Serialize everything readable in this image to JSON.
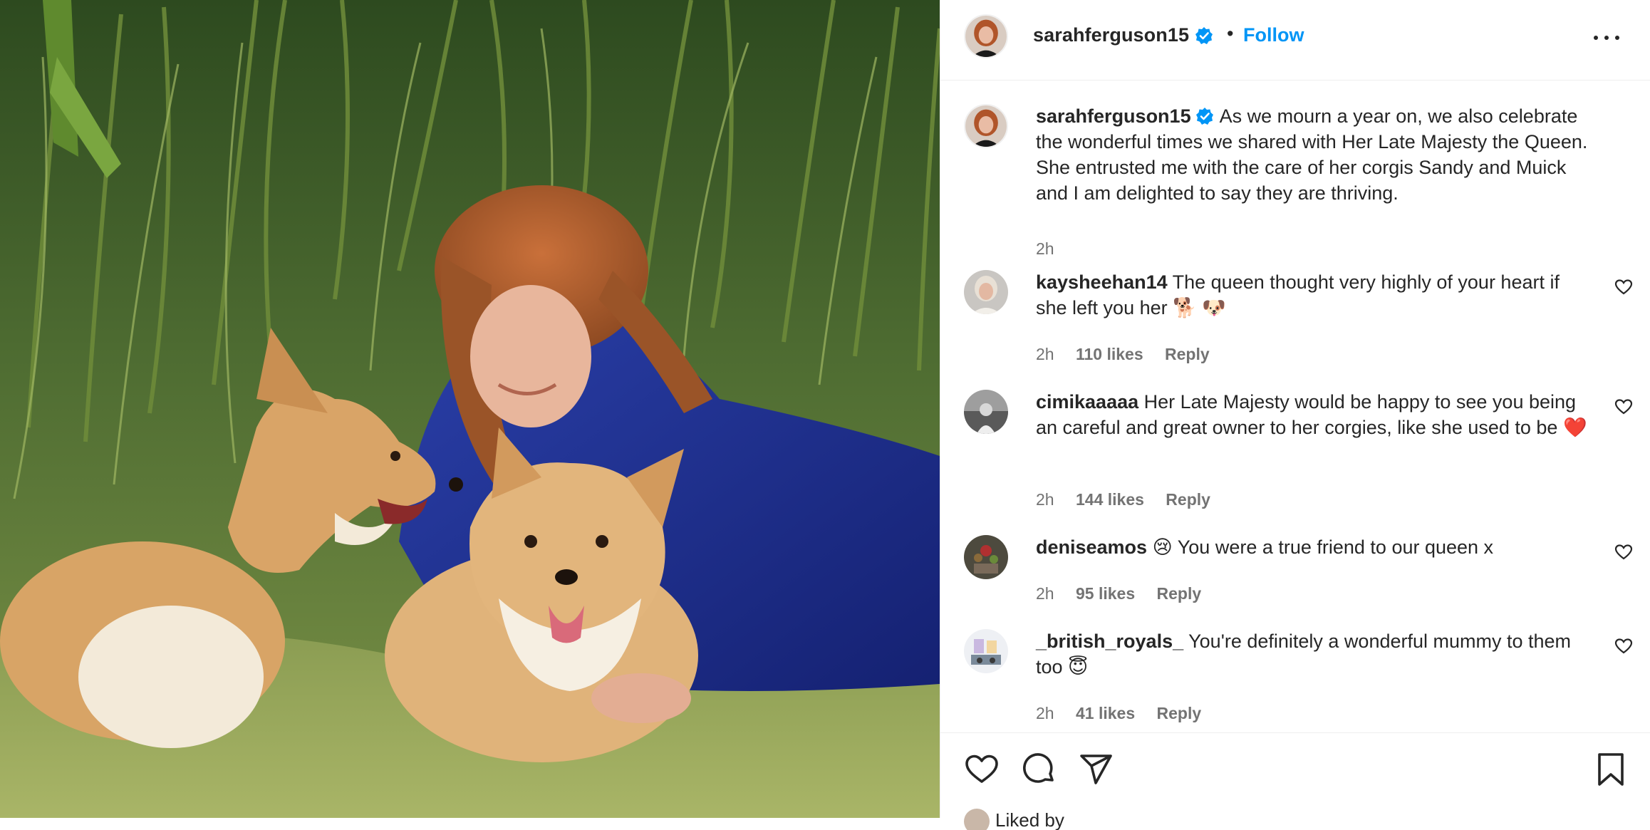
{
  "header": {
    "username": "sarahferguson15",
    "separator": "•",
    "follow_label": "Follow"
  },
  "caption": {
    "username": "sarahferguson15",
    "text": "As we mourn a year on, we also celebrate the wonderful times we shared with Her Late Majesty the Queen. She entrusted me with the care of her corgis Sandy and Muick and I am delighted to say they are thriving.",
    "time": "2h"
  },
  "comments": [
    {
      "username": "kaysheehan14",
      "text": "The queen thought very highly of your heart if she left you her 🐕 🐶",
      "time": "2h",
      "likes": "110 likes",
      "reply": "Reply"
    },
    {
      "username": "cimikaaaaa",
      "text": "Her Late Majesty would be happy to see you being an careful and great owner to her corgies, like she used to be ❤️",
      "time": "2h",
      "likes": "144 likes",
      "reply": "Reply"
    },
    {
      "username": "deniseamos",
      "text": "😢 You were a true friend to our queen x",
      "time": "2h",
      "likes": "95 likes",
      "reply": "Reply"
    },
    {
      "username": "_british_royals_",
      "text": "You're definitely a wonderful mummy to them too 😇",
      "time": "2h",
      "likes": "41 likes",
      "reply": "Reply"
    }
  ],
  "footer": {
    "liked_by": "Liked by"
  },
  "icons": {
    "verified": "verified-badge-icon",
    "more": "more-options-icon",
    "like": "heart-icon",
    "comment": "comment-icon",
    "share": "share-icon",
    "save": "bookmark-icon"
  },
  "colors": {
    "accent": "#0095f6",
    "text": "#262626",
    "muted": "#737373",
    "verified": "#0095f6"
  }
}
